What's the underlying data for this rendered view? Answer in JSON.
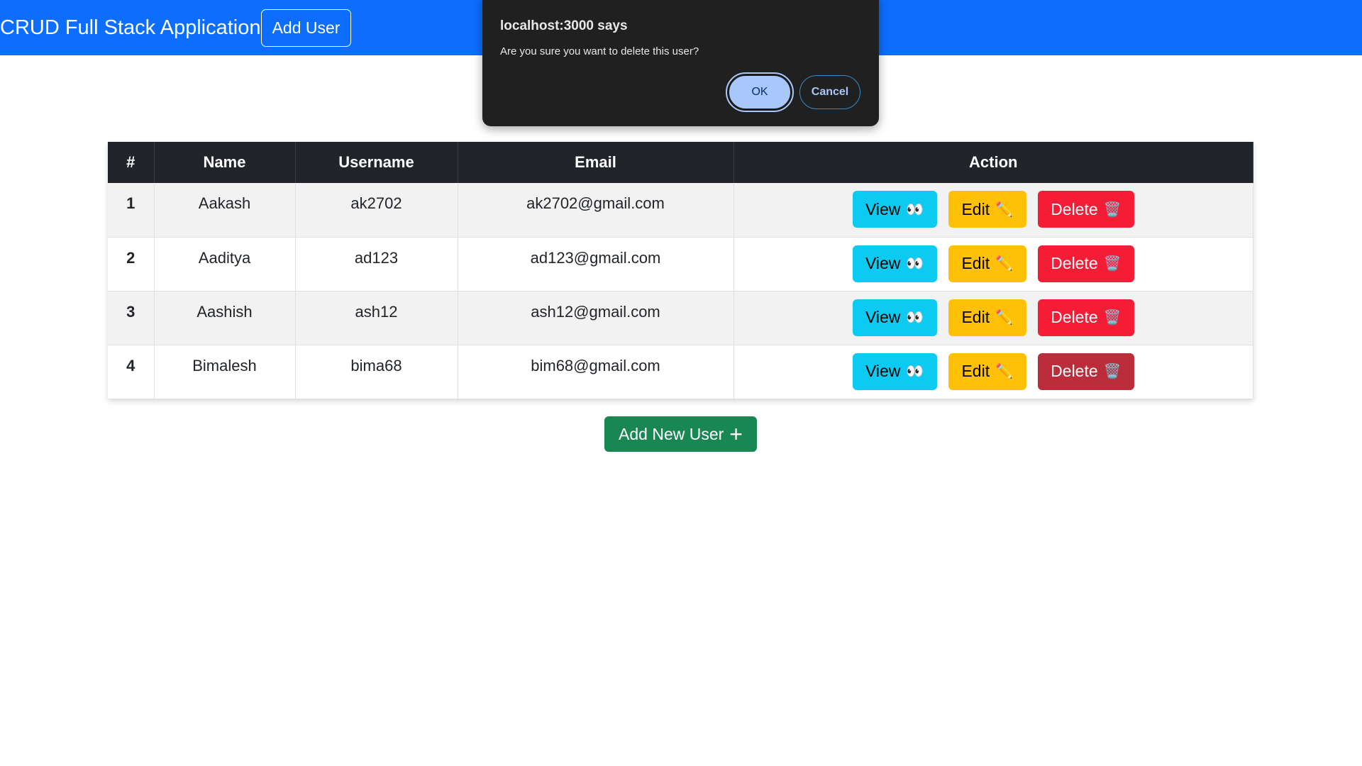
{
  "navbar": {
    "title": "CRUD Full Stack Application",
    "add_user": "Add User",
    "color": "#0d6efd"
  },
  "dialog": {
    "title": "localhost:3000 says",
    "message": "Are you sure you want to delete this user?",
    "ok": "OK",
    "cancel": "Cancel"
  },
  "table": {
    "headers": [
      "#",
      "Name",
      "Username",
      "Email",
      "Action"
    ],
    "rows": [
      {
        "id": "1",
        "name": "Aakash",
        "username": "ak2702",
        "email": "ak2702@gmail.com"
      },
      {
        "id": "2",
        "name": "Aaditya",
        "username": "ad123",
        "email": "ad123@gmail.com"
      },
      {
        "id": "3",
        "name": "Aashish",
        "username": "ash12",
        "email": "ash12@gmail.com"
      },
      {
        "id": "4",
        "name": "Bimalesh",
        "username": "bima68",
        "email": "bim68@gmail.com"
      }
    ],
    "actions": {
      "view": "View",
      "view_icon": "👀",
      "edit": "Edit",
      "edit_icon": "✏️",
      "delete": "Delete",
      "delete_icon": "🗑️"
    }
  },
  "add_new_user": {
    "label": "Add New User",
    "icon": "+"
  }
}
